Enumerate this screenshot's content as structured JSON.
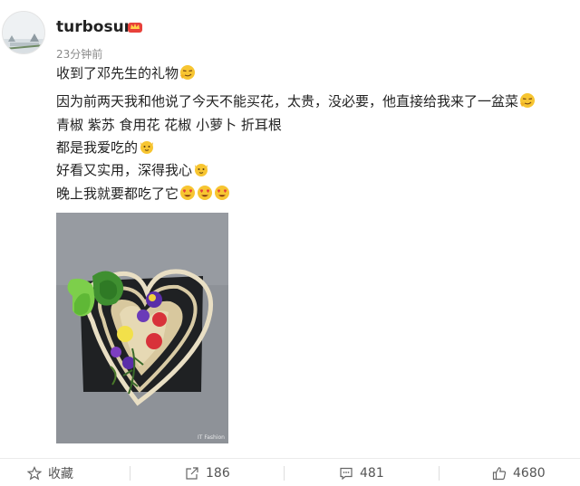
{
  "post": {
    "username": "turbosun",
    "timestamp": "23分钟前",
    "lines": [
      "收到了邓先生的礼物",
      "因为前两天我和他说了今天不能买花，太贵，没必要，他直接给我来了一盆菜",
      "青椒 紫苏 食用花 花椒 小萝卜 折耳根",
      "都是我爱吃的",
      "好看又实用，深得我心",
      "晚上我就要都吃了它"
    ],
    "photo_watermark": "IT Fashion"
  },
  "actions": {
    "favorite_label": "收藏",
    "share_count": "186",
    "comment_count": "481",
    "like_count": "4680"
  },
  "icons": {
    "badge": "crown-badge-icon",
    "emoji_smirk": "smirk-emoji-icon",
    "emoji_cat": "cat-face-emoji-icon",
    "emoji_heart_eyes": "heart-eyes-emoji-icon"
  },
  "colors": {
    "text": "#222222",
    "muted": "#8a8a8a",
    "emoji_yellow": "#f7c531",
    "badge_red": "#e8413a"
  }
}
